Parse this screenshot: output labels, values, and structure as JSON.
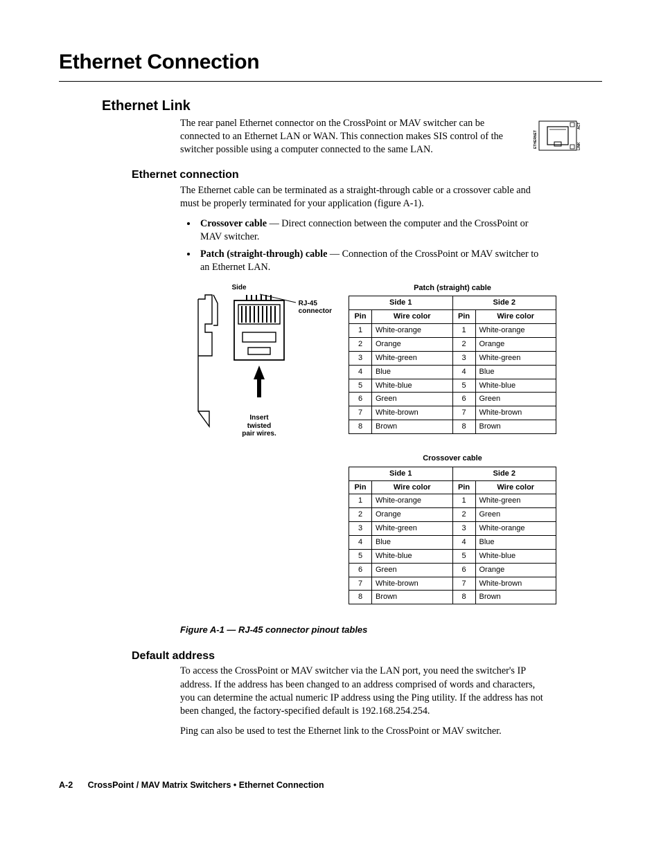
{
  "page_title": "Ethernet Connection",
  "h2": "Ethernet Link",
  "intro": "The rear panel Ethernet connector on the CrossPoint or MAV switcher can be connected to an Ethernet LAN or WAN.  This connection makes SIS control of the switcher possible using a computer connected to the same LAN.",
  "eth_icon": {
    "top": "ETHERNET",
    "left": "LINK",
    "right": "ACT"
  },
  "h3_conn": "Ethernet connection",
  "conn_para": "The Ethernet cable can be terminated as a straight-through cable or a crossover cable and must be properly terminated for your application (figure A-1).",
  "bullets": [
    {
      "bold": "Crossover cable",
      "rest": " — Direct connection between the computer and the CrossPoint or MAV switcher."
    },
    {
      "bold": "Patch (straight-through) cable",
      "rest": " — Connection of the CrossPoint or MAV switcher to an Ethernet LAN."
    }
  ],
  "rj45_diag": {
    "side": "Side",
    "conn": "RJ-45\nconnector",
    "insert": "Insert\ntwisted\npair wires."
  },
  "patch_title": "Patch (straight) cable",
  "cross_title": "Crossover cable",
  "headers": {
    "side1": "Side 1",
    "side2": "Side 2",
    "pin": "Pin",
    "wc": "Wire color"
  },
  "patch_rows": [
    {
      "p1": "1",
      "c1": "White-orange",
      "p2": "1",
      "c2": "White-orange"
    },
    {
      "p1": "2",
      "c1": "Orange",
      "p2": "2",
      "c2": "Orange"
    },
    {
      "p1": "3",
      "c1": "White-green",
      "p2": "3",
      "c2": "White-green"
    },
    {
      "p1": "4",
      "c1": "Blue",
      "p2": "4",
      "c2": "Blue"
    },
    {
      "p1": "5",
      "c1": "White-blue",
      "p2": "5",
      "c2": "White-blue"
    },
    {
      "p1": "6",
      "c1": "Green",
      "p2": "6",
      "c2": "Green"
    },
    {
      "p1": "7",
      "c1": "White-brown",
      "p2": "7",
      "c2": "White-brown"
    },
    {
      "p1": "8",
      "c1": "Brown",
      "p2": "8",
      "c2": "Brown"
    }
  ],
  "cross_rows": [
    {
      "p1": "1",
      "c1": "White-orange",
      "p2": "1",
      "c2": "White-green"
    },
    {
      "p1": "2",
      "c1": "Orange",
      "p2": "2",
      "c2": "Green"
    },
    {
      "p1": "3",
      "c1": "White-green",
      "p2": "3",
      "c2": "White-orange"
    },
    {
      "p1": "4",
      "c1": "Blue",
      "p2": "4",
      "c2": "Blue"
    },
    {
      "p1": "5",
      "c1": "White-blue",
      "p2": "5",
      "c2": "White-blue"
    },
    {
      "p1": "6",
      "c1": "Green",
      "p2": "6",
      "c2": "Orange"
    },
    {
      "p1": "7",
      "c1": "White-brown",
      "p2": "7",
      "c2": "White-brown"
    },
    {
      "p1": "8",
      "c1": "Brown",
      "p2": "8",
      "c2": "Brown"
    }
  ],
  "fig_caption": "Figure A-1 — RJ-45 connector pinout tables",
  "h3_addr": "Default address",
  "addr_p1": "To access the CrossPoint or MAV switcher via the LAN port, you need the switcher's IP address.  If the address has been changed to an address comprised of words and characters, you can determine the actual numeric IP address using the Ping utility.  If the address has not been changed, the factory-specified default is 192.168.254.254.",
  "addr_p2": "Ping can also be used to test the Ethernet link to the CrossPoint or MAV switcher.",
  "footer": {
    "page": "A-2",
    "doc": "CrossPoint / MAV Matrix Switchers • Ethernet Connection"
  }
}
